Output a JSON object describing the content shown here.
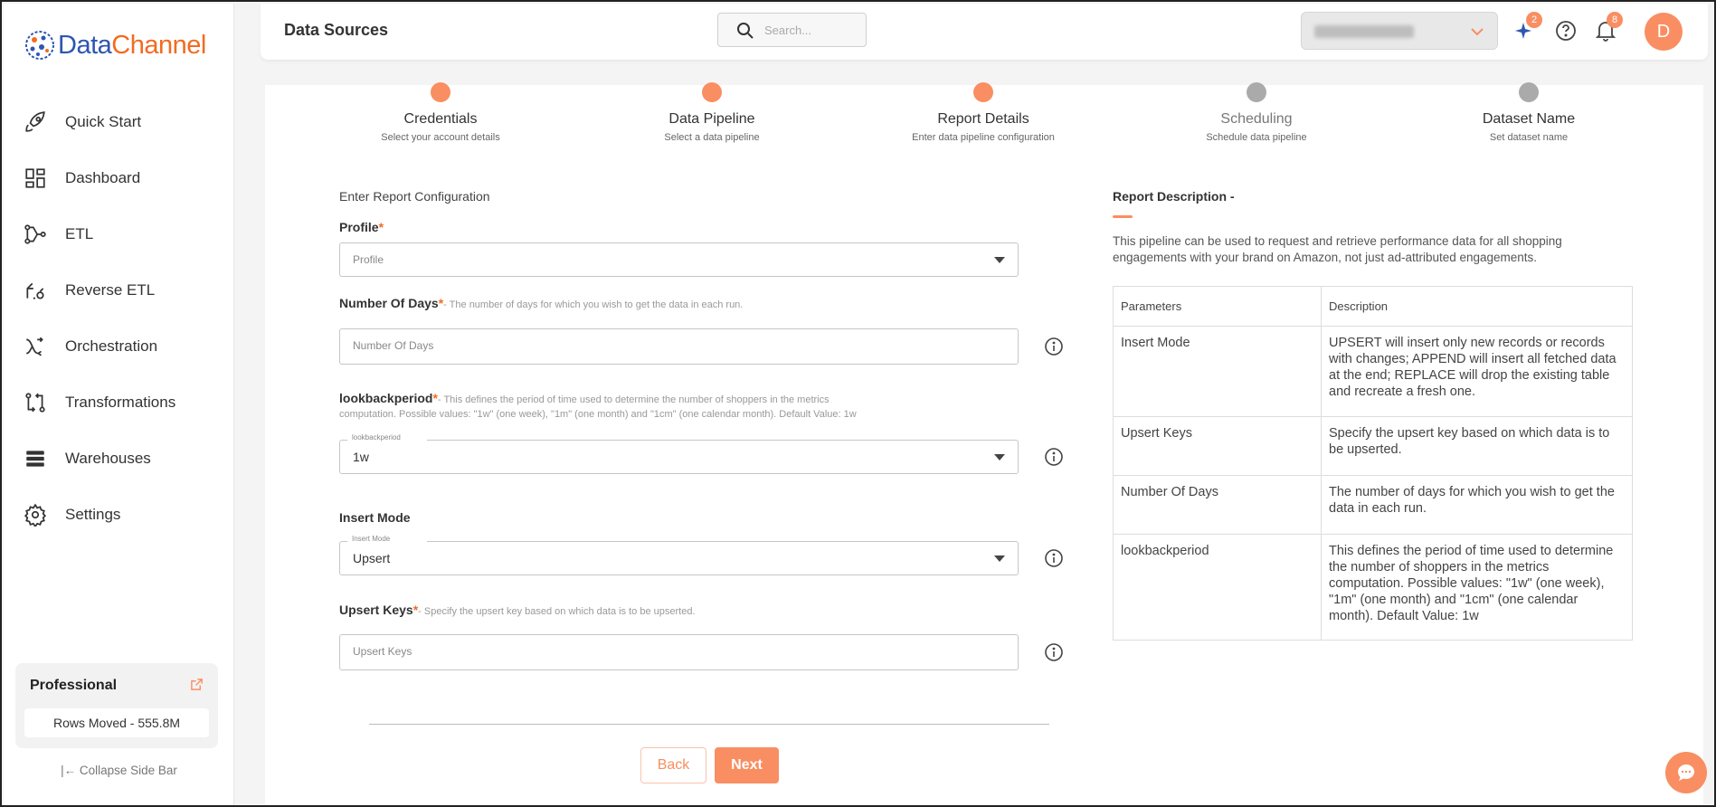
{
  "brand": {
    "name_part1": "Data",
    "name_part2": "Channel",
    "accent": "#f98e62",
    "blue": "#2d56b0"
  },
  "sidebar": {
    "items": [
      {
        "label": "Quick Start",
        "icon": "rocket-icon"
      },
      {
        "label": "Dashboard",
        "icon": "dashboard-icon"
      },
      {
        "label": "ETL",
        "icon": "etl-icon"
      },
      {
        "label": "Reverse ETL",
        "icon": "reverse-etl-icon"
      },
      {
        "label": "Orchestration",
        "icon": "orchestration-icon"
      },
      {
        "label": "Transformations",
        "icon": "transformations-icon"
      },
      {
        "label": "Warehouses",
        "icon": "warehouses-icon"
      },
      {
        "label": "Settings",
        "icon": "gear-icon"
      }
    ],
    "plan": {
      "title": "Professional",
      "rows_moved": "Rows Moved - 555.8M"
    },
    "collapse_label": "Collapse Side Bar"
  },
  "header": {
    "title": "Data Sources",
    "search_placeholder": "Search...",
    "ai_badge": "2",
    "notifications_badge": "8",
    "avatar_initial": "D"
  },
  "steps": [
    {
      "title": "Credentials",
      "subtitle": "Select your account details",
      "state": "done"
    },
    {
      "title": "Data Pipeline",
      "subtitle": "Select a data pipeline",
      "state": "done"
    },
    {
      "title": "Report Details",
      "subtitle": "Enter data pipeline configuration",
      "state": "active"
    },
    {
      "title": "Scheduling",
      "subtitle": "Schedule data pipeline",
      "state": "pending"
    },
    {
      "title": "Dataset Name",
      "subtitle": "Set dataset name",
      "state": "pending"
    }
  ],
  "form": {
    "section_title": "Enter Report Configuration",
    "profile": {
      "label": "Profile",
      "required": "*",
      "placeholder": "Profile"
    },
    "num_days": {
      "label": "Number Of Days",
      "required": "*",
      "hint": "- The number of days for which you wish to get the data in each run.",
      "placeholder": "Number Of Days"
    },
    "lookback": {
      "label": "lookbackperiod",
      "required": "*",
      "hint1": "- This defines the period of time used to determine the number of shoppers in the metrics",
      "hint2": "computation. Possible values: \"1w\" (one week), \"1m\" (one month) and \"1cm\" (one calendar month). Default Value: 1w",
      "legend": "lookbackperiod",
      "value": "1w"
    },
    "insert_mode": {
      "label": "Insert Mode",
      "legend": "Insert Mode",
      "value": "Upsert"
    },
    "upsert_keys": {
      "label": "Upsert Keys",
      "required": "*",
      "hint": "- Specify the upsert key based on which data is to be upserted.",
      "placeholder": "Upsert Keys"
    },
    "back_label": "Back",
    "next_label": "Next"
  },
  "report_description": {
    "title": "Report Description -",
    "text": "This pipeline can be used to request and retrieve performance data for all shopping engagements with your brand on Amazon, not just ad-attributed engagements.",
    "table": {
      "headers": [
        "Parameters",
        "Description"
      ],
      "rows": [
        {
          "param": "Insert Mode",
          "desc": "UPSERT will insert only new records or records with changes; APPEND will insert all fetched data at the end; REPLACE will drop the existing table and recreate a fresh one."
        },
        {
          "param": "Upsert Keys",
          "desc": "Specify the upsert key based on which data is to be upserted."
        },
        {
          "param": "Number Of Days",
          "desc": "The number of days for which you wish to get the data in each run."
        },
        {
          "param": "lookbackperiod",
          "desc": "This defines the period of time used to determine the number of shoppers in the metrics computation. Possible values: \"1w\" (one week), \"1m\" (one month) and \"1cm\" (one calendar month). Default Value: 1w"
        }
      ]
    }
  }
}
